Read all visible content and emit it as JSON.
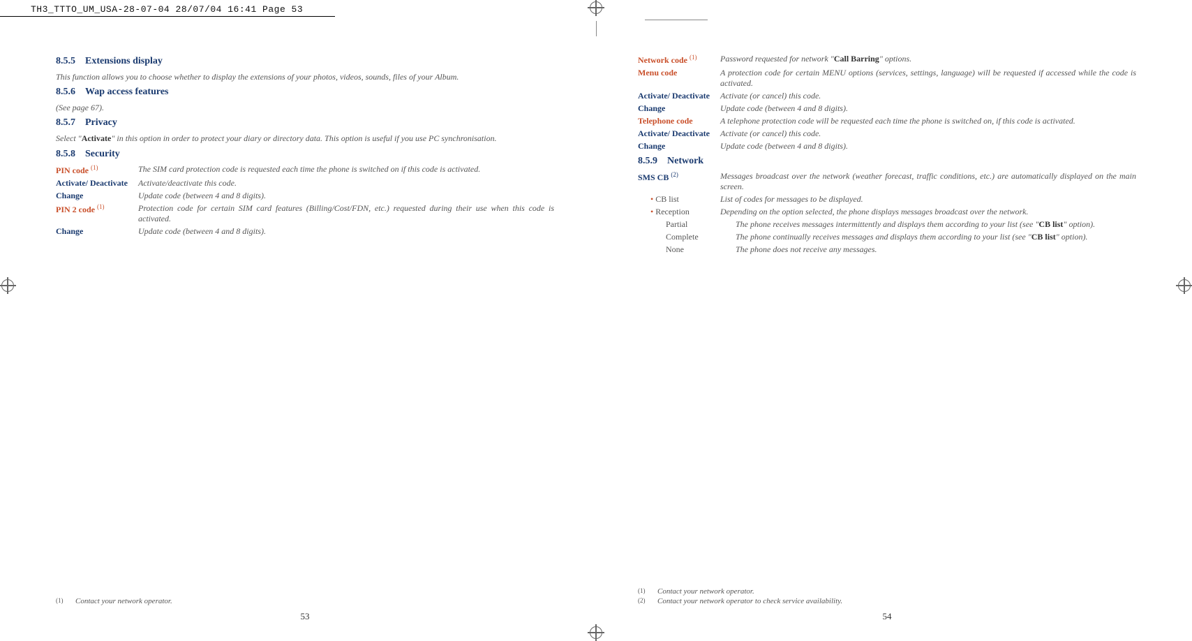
{
  "slug": "TH3_TTTO_UM_USA-28-07-04  28/07/04  16:41  Page 53",
  "left": {
    "pagenum": "53",
    "s855": {
      "num": "8.5.5",
      "title": "Extensions display",
      "text": "This function allows you to choose whether to display the extensions of your photos, videos, sounds, files of your Album."
    },
    "s856": {
      "num": "8.5.6",
      "title": "Wap access features",
      "text": "(See page 67)."
    },
    "s857": {
      "num": "8.5.7",
      "title": "Privacy",
      "text_pre": "Select \"",
      "text_bold": "Activate",
      "text_post": "\" in this option in order to protect your diary or directory data. This option is useful if you use PC synchronisation."
    },
    "s858": {
      "num": "8.5.8",
      "title": "Security"
    },
    "pin": {
      "label": "PIN code",
      "ref": "(1)",
      "def": "The SIM card protection code is requested each time the phone is switched on if this code is activated."
    },
    "act1": {
      "label": "Activate/ Deactivate",
      "def": "Activate/deactivate this code."
    },
    "chg1": {
      "label": "Change",
      "def": "Update code (between 4 and 8 digits)."
    },
    "pin2": {
      "label": "PIN 2 code",
      "ref": "(1)",
      "def": "Protection code for certain SIM card features (Billing/Cost/FDN, etc.) requested during their use when this code is activated."
    },
    "chg2": {
      "label": "Change",
      "def": "Update code (between 4 and 8 digits)."
    },
    "foot1": {
      "n": "(1)",
      "t": "Contact your network operator."
    }
  },
  "right": {
    "pagenum": "54",
    "net": {
      "label": "Network code",
      "ref": "(1)",
      "def_pre": "Password requested for network \"",
      "def_bold": "Call Barring",
      "def_post": "\" options."
    },
    "menu": {
      "label": "Menu code",
      "def": "A protection code for certain MENU options (services, settings, language) will be requested if accessed while the code is activated."
    },
    "act2": {
      "label": "Activate/ Deactivate",
      "def": "Activate (or cancel) this code."
    },
    "chg3": {
      "label": "Change",
      "def": "Update code (between 4 and 8 digits)."
    },
    "tel": {
      "label": "Telephone code",
      "def": "A telephone protection code will be requested each time the phone is switched on, if this code is activated."
    },
    "act3": {
      "label": "Activate/ Deactivate",
      "def": "Activate (or cancel) this code."
    },
    "chg4": {
      "label": "Change",
      "def": "Update code (between 4 and 8 digits)."
    },
    "s859": {
      "num": "8.5.9",
      "title": "Network"
    },
    "sms": {
      "label": "SMS CB",
      "ref": "(2)",
      "def": "Messages broadcast over the network (weather forecast, traffic conditions, etc.) are automatically displayed on the main screen."
    },
    "cbl": {
      "label": "CB list",
      "def": "List of codes for messages to be displayed."
    },
    "rec": {
      "label": "Reception",
      "def": "Depending on the option selected, the phone displays messages broadcast over the network."
    },
    "part": {
      "label": "Partial",
      "def_pre": "The phone receives messages intermittently and displays them according to your list (see \"",
      "def_bold": "CB list",
      "def_post": "\" option)."
    },
    "comp": {
      "label": "Complete",
      "def_pre": "The phone continually receives messages and displays them according to your list (see \"",
      "def_bold": "CB list",
      "def_post": "\" option)."
    },
    "none": {
      "label": "None",
      "def": "The phone does not receive any messages."
    },
    "foot1": {
      "n": "(1)",
      "t": "Contact your network operator."
    },
    "foot2": {
      "n": "(2)",
      "t": "Contact your network operator to check service availability."
    }
  }
}
